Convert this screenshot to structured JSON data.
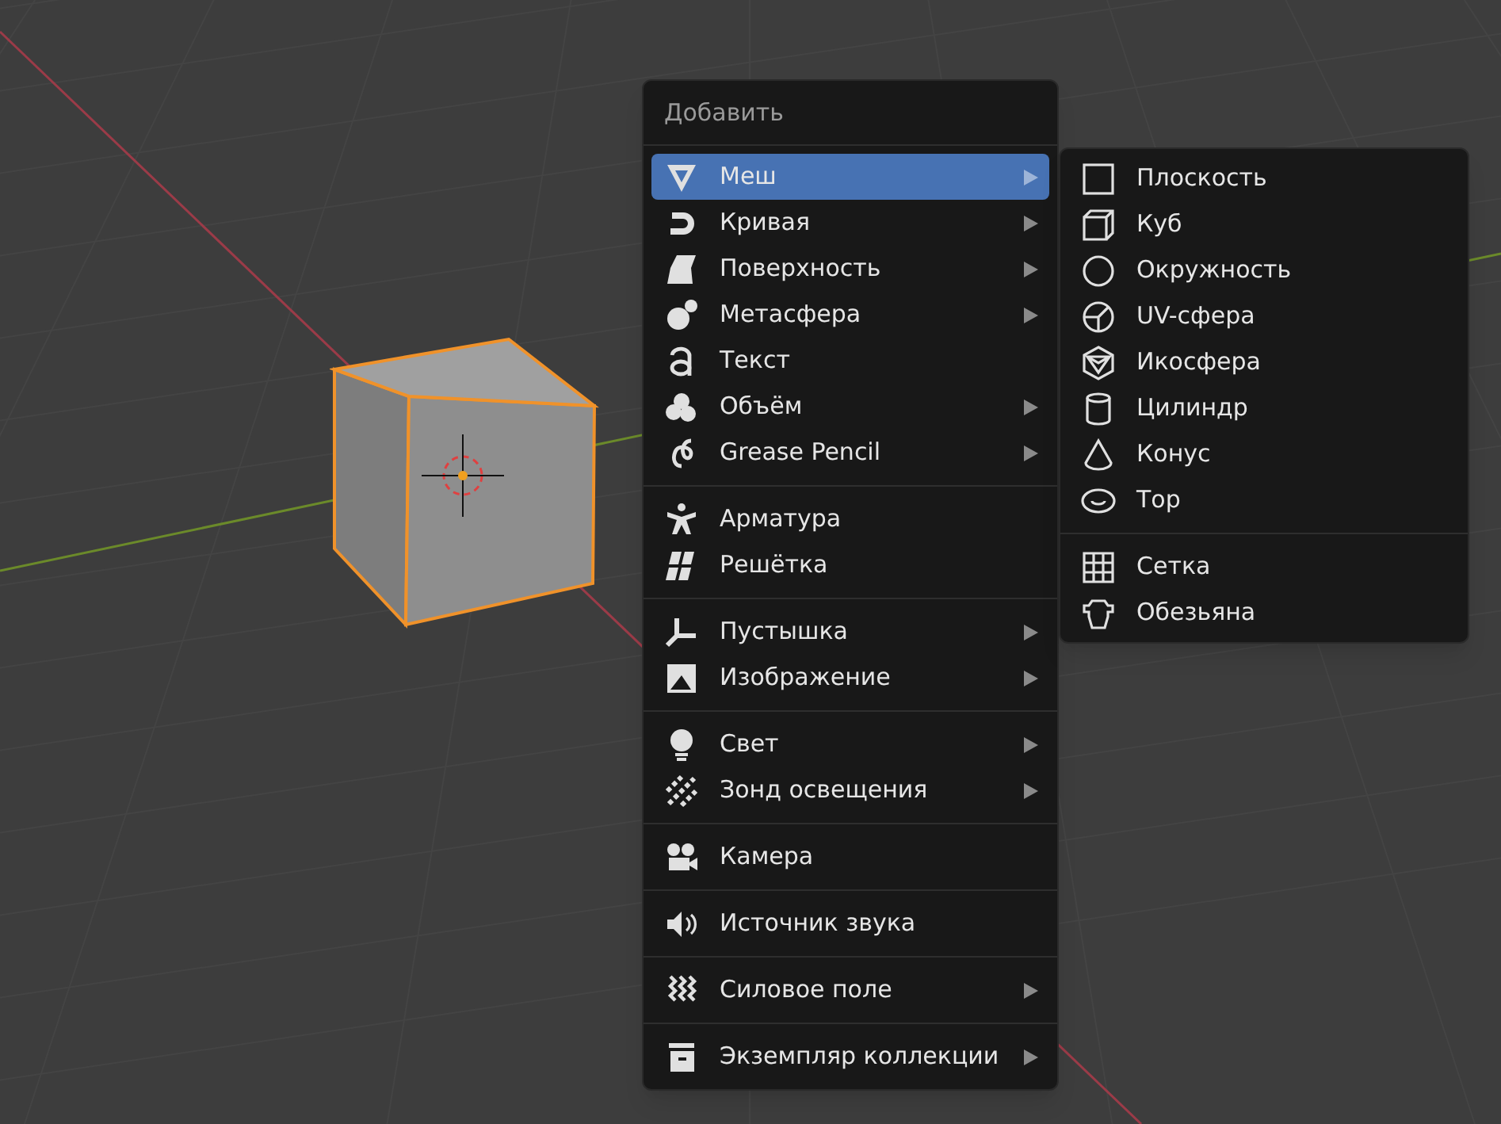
{
  "menu": {
    "title": "Добавить",
    "groups": [
      {
        "items": [
          {
            "label": "Меш",
            "has_submenu": true,
            "selected": true
          },
          {
            "label": "Кривая",
            "has_submenu": true,
            "selected": false
          },
          {
            "label": "Поверхность",
            "has_submenu": true,
            "selected": false
          },
          {
            "label": "Метасфера",
            "has_submenu": true,
            "selected": false
          },
          {
            "label": "Текст",
            "has_submenu": false,
            "selected": false
          },
          {
            "label": "Объём",
            "has_submenu": true,
            "selected": false
          },
          {
            "label": "Grease Pencil",
            "has_submenu": true,
            "selected": false
          }
        ]
      },
      {
        "items": [
          {
            "label": "Арматура",
            "has_submenu": false,
            "selected": false
          },
          {
            "label": "Решётка",
            "has_submenu": false,
            "selected": false
          }
        ]
      },
      {
        "items": [
          {
            "label": "Пустышка",
            "has_submenu": true,
            "selected": false
          },
          {
            "label": "Изображение",
            "has_submenu": true,
            "selected": false
          }
        ]
      },
      {
        "items": [
          {
            "label": "Свет",
            "has_submenu": true,
            "selected": false
          },
          {
            "label": "Зонд освещения",
            "has_submenu": true,
            "selected": false
          }
        ]
      },
      {
        "items": [
          {
            "label": "Камера",
            "has_submenu": false,
            "selected": false
          }
        ]
      },
      {
        "items": [
          {
            "label": "Источник звука",
            "has_submenu": false,
            "selected": false
          }
        ]
      },
      {
        "items": [
          {
            "label": "Силовое поле",
            "has_submenu": true,
            "selected": false
          }
        ]
      },
      {
        "items": [
          {
            "label": "Экземпляр коллекции",
            "has_submenu": true,
            "selected": false
          }
        ]
      }
    ]
  },
  "submenu": {
    "groups": [
      {
        "items": [
          {
            "label": "Плоскость",
            "selected": false
          },
          {
            "label": "Куб",
            "selected": false
          },
          {
            "label": "Окружность",
            "selected": false
          },
          {
            "label": "UV-сфера",
            "selected": false
          },
          {
            "label": "Икосфера",
            "selected": false
          },
          {
            "label": "Цилиндр",
            "selected": false
          },
          {
            "label": "Конус",
            "selected": false
          },
          {
            "label": "Тор",
            "selected": false
          }
        ]
      },
      {
        "items": [
          {
            "label": "Сетка",
            "selected": false
          },
          {
            "label": "Обезьяна",
            "selected": false
          }
        ]
      }
    ]
  }
}
